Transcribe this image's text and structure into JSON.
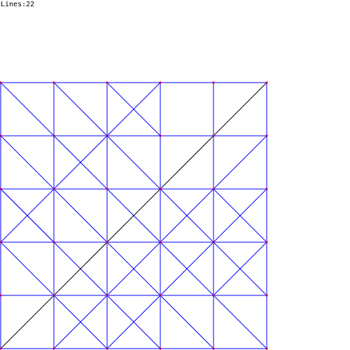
{
  "hud": {
    "lines_text": "Lines:22"
  },
  "colors": {
    "background": "#ffffff",
    "line_blue": "#0000ff",
    "line_black": "#000000",
    "dot": "#c00060",
    "text": "#000000"
  },
  "board": {
    "cols": 6,
    "rows": 6,
    "segments": [
      {
        "from": [
          0,
          0
        ],
        "to": [
          5,
          0
        ],
        "color": "blue"
      },
      {
        "from": [
          0,
          1
        ],
        "to": [
          5,
          1
        ],
        "color": "blue"
      },
      {
        "from": [
          0,
          2
        ],
        "to": [
          5,
          2
        ],
        "color": "blue"
      },
      {
        "from": [
          0,
          3
        ],
        "to": [
          5,
          3
        ],
        "color": "blue"
      },
      {
        "from": [
          0,
          4
        ],
        "to": [
          5,
          4
        ],
        "color": "blue"
      },
      {
        "from": [
          0,
          5
        ],
        "to": [
          5,
          5
        ],
        "color": "blue"
      },
      {
        "from": [
          0,
          0
        ],
        "to": [
          0,
          5
        ],
        "color": "blue"
      },
      {
        "from": [
          1,
          0
        ],
        "to": [
          1,
          5
        ],
        "color": "blue"
      },
      {
        "from": [
          2,
          0
        ],
        "to": [
          2,
          5
        ],
        "color": "blue"
      },
      {
        "from": [
          3,
          0
        ],
        "to": [
          3,
          5
        ],
        "color": "blue"
      },
      {
        "from": [
          4,
          0
        ],
        "to": [
          4,
          5
        ],
        "color": "blue"
      },
      {
        "from": [
          5,
          0
        ],
        "to": [
          5,
          5
        ],
        "color": "blue"
      },
      {
        "from": [
          0,
          0
        ],
        "to": [
          5,
          5
        ],
        "color": "blue"
      },
      {
        "from": [
          1,
          0
        ],
        "to": [
          5,
          4
        ],
        "color": "blue"
      },
      {
        "from": [
          2,
          0
        ],
        "to": [
          3,
          1
        ],
        "color": "blue"
      },
      {
        "from": [
          0,
          1
        ],
        "to": [
          4,
          5
        ],
        "color": "blue"
      },
      {
        "from": [
          0,
          2
        ],
        "to": [
          3,
          5
        ],
        "color": "blue"
      },
      {
        "from": [
          0,
          3
        ],
        "to": [
          2,
          5
        ],
        "color": "blue"
      },
      {
        "from": [
          0,
          3
        ],
        "to": [
          3,
          0
        ],
        "color": "blue"
      },
      {
        "from": [
          0,
          2
        ],
        "to": [
          1,
          3
        ],
        "color": "blue"
      },
      {
        "from": [
          4,
          2
        ],
        "to": [
          5,
          3
        ],
        "color": "blue"
      },
      {
        "from": [
          5,
          0
        ],
        "to": [
          0,
          5
        ],
        "color": "black"
      },
      {
        "from": [
          5,
          1
        ],
        "to": [
          1,
          5
        ],
        "color": "blue"
      },
      {
        "from": [
          5,
          2
        ],
        "to": [
          2,
          5
        ],
        "color": "blue"
      },
      {
        "from": [
          5,
          3
        ],
        "to": [
          4,
          4
        ],
        "color": "blue"
      }
    ]
  }
}
